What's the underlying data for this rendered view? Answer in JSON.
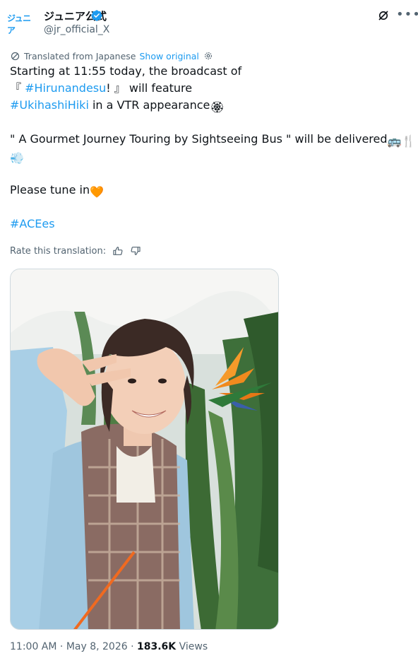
{
  "author": {
    "display_name": "ジュニア公式",
    "handle": "@jr_official_X",
    "avatar_text": "ジュニア",
    "verified": true,
    "avatar_icon": "brand-logo"
  },
  "translation": {
    "label": "Translated from Japanese",
    "show_original": "Show original"
  },
  "tweet": {
    "line1": "Starting at 11:55 today, the broadcast of",
    "line2_open": "『 ",
    "line2_tag": "#Hirunandesu",
    "line2_close": "! 』 will feature",
    "line3_tag": "#UkihashiHiki",
    "line3_rest": " in a VTR appearance",
    "line3_emoji": "🏵",
    "line5": "\" A Gourmet Journey Touring by Sightseeing Bus \" will be delivered",
    "line5_emoji": "🚌🍴",
    "line6_emoji": "💨",
    "line8": "Please tune in",
    "line8_emoji": "🧡",
    "line10_tag": "#ACEes"
  },
  "rate": {
    "label": "Rate this translation:",
    "up_icon": "thumbs-up-icon",
    "down_icon": "thumbs-down-icon"
  },
  "meta": {
    "time": "11:00 AM",
    "separator1": " · ",
    "date": "May 8, 2026",
    "separator2": " · ",
    "views_count": "183.6K",
    "views_label": " Views"
  },
  "colors": {
    "link": "#1d9bf0",
    "text": "#0f1419",
    "secondary": "#536471"
  }
}
